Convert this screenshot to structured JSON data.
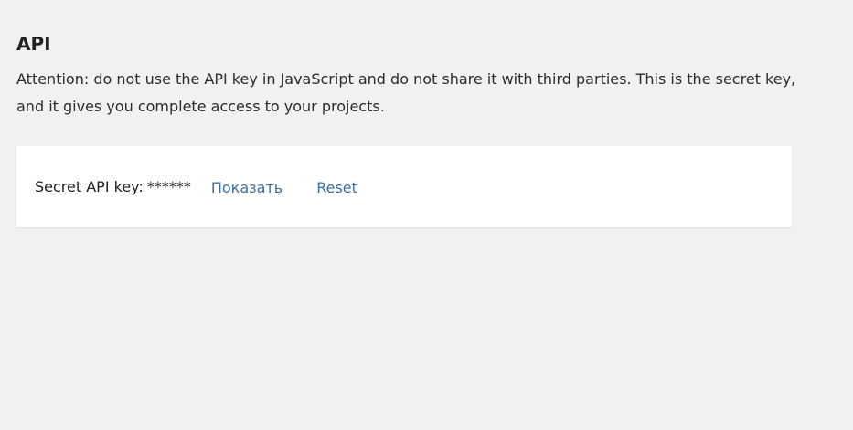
{
  "page": {
    "title": "API",
    "description": "Attention: do not use the API key in JavaScript and do not share it with third parties. This is the secret key, and it gives you complete access to your projects."
  },
  "api_key_card": {
    "label": "Secret API key:",
    "masked_value": "******",
    "show_label": "Показать",
    "reset_label": "Reset"
  },
  "colors": {
    "background": "#f0f1f3",
    "card": "#ffffff",
    "link": "#3e6e9e",
    "text": "#222222"
  }
}
